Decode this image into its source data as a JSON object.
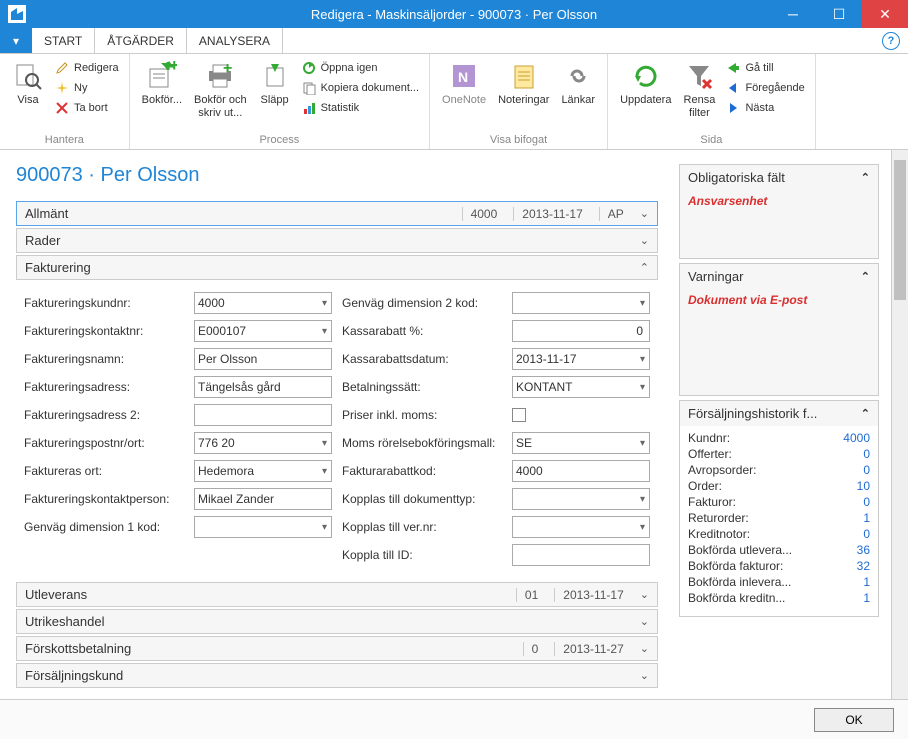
{
  "window": {
    "title": "Redigera - Maskinsäljorder - 900073 · Per Olsson"
  },
  "tabs": {
    "start": "START",
    "atgarder": "ÅTGÄRDER",
    "analysera": "ANALYSERA"
  },
  "ribbon": {
    "visa": "Visa",
    "redigera": "Redigera",
    "ny": "Ny",
    "tabort": "Ta bort",
    "hantera": "Hantera",
    "bokfor": "Bokför...",
    "bokfor_skriv": "Bokför och\nskriv ut...",
    "slapp": "Släpp",
    "oppna": "Öppna igen",
    "kopiera": "Kopiera dokument...",
    "statistik": "Statistik",
    "process": "Process",
    "onenote": "OneNote",
    "noteringar": "Noteringar",
    "lankar": "Länkar",
    "visa_bifogat": "Visa bifogat",
    "uppdatera": "Uppdatera",
    "rensa": "Rensa\nfilter",
    "gatill": "Gå till",
    "foreg": "Föregående",
    "nasta": "Nästa",
    "sida": "Sida"
  },
  "header": "900073 · Per Olsson",
  "acc": {
    "allmant": {
      "t": "Allmänt",
      "m1": "4000",
      "m2": "2013-11-17",
      "m3": "AP"
    },
    "rader": {
      "t": "Rader"
    },
    "fakturering": {
      "t": "Fakturering"
    },
    "utleverans": {
      "t": "Utleverans",
      "m1": "01",
      "m2": "2013-11-17"
    },
    "utrikes": {
      "t": "Utrikeshandel"
    },
    "forskott": {
      "t": "Förskottsbetalning",
      "m1": "0",
      "m2": "2013-11-27"
    },
    "forsalj": {
      "t": "Försäljningskund"
    }
  },
  "form": {
    "l": {
      "kundnr": "Faktureringskundnr:",
      "kontaktnr": "Faktureringskontaktnr:",
      "namn": "Faktureringsnamn:",
      "adress": "Faktureringsadress:",
      "adress2": "Faktureringsadress 2:",
      "postnr": "Faktureringspostnr/ort:",
      "ort": "Faktureras ort:",
      "kontaktperson": "Faktureringskontaktperson:",
      "dim1": "Genväg dimension 1 kod:"
    },
    "lv": {
      "kundnr": "4000",
      "kontaktnr": "E000107",
      "namn": "Per Olsson",
      "adress": "Tängelsås gård",
      "adress2": "",
      "postnr": "776 20",
      "ort": "Hedemora",
      "kontaktperson": "Mikael Zander",
      "dim1": ""
    },
    "r": {
      "dim2": "Genväg dimension 2 kod:",
      "kassarabatt": "Kassarabatt %:",
      "kassadatum": "Kassarabattsdatum:",
      "betalning": "Betalningssätt:",
      "priser": "Priser inkl. moms:",
      "moms": "Moms rörelsebokföringsmall:",
      "fakturarabatt": "Fakturarabattkod:",
      "kopptyp": "Kopplas till dokumenttyp:",
      "koppver": "Kopplas till ver.nr:",
      "koppid": "Koppla till ID:"
    },
    "rv": {
      "dim2": "",
      "kassarabatt": "0",
      "kassadatum": "2013-11-17",
      "betalning": "KONTANT",
      "moms": "SE",
      "fakturarabatt": "4000",
      "kopptyp": "",
      "koppver": "",
      "koppid": ""
    }
  },
  "side": {
    "oblig": {
      "t": "Obligatoriska fält",
      "w": "Ansvarsenhet"
    },
    "varn": {
      "t": "Varningar",
      "w": "Dokument via E-post"
    },
    "hist": {
      "t": "Försäljningshistorik f...",
      "rows": [
        {
          "l": "Kundnr:",
          "v": "4000"
        },
        {
          "l": "Offerter:",
          "v": "0"
        },
        {
          "l": "Avropsorder:",
          "v": "0"
        },
        {
          "l": "Order:",
          "v": "10"
        },
        {
          "l": "Fakturor:",
          "v": "0"
        },
        {
          "l": "Returorder:",
          "v": "1"
        },
        {
          "l": "Kreditnotor:",
          "v": "0"
        },
        {
          "l": "Bokförda utlevera...",
          "v": "36"
        },
        {
          "l": "Bokförda fakturor:",
          "v": "32"
        },
        {
          "l": "Bokförda inlevera...",
          "v": "1"
        },
        {
          "l": "Bokförda kreditn...",
          "v": "1"
        }
      ]
    }
  },
  "footer": {
    "ok": "OK"
  }
}
